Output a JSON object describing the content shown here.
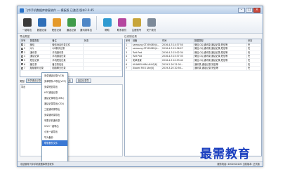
{
  "window": {
    "title": "飞华手机数据库修复软件 — 模板版 已激活 版本2.0.45",
    "controls": [
      "–",
      "□",
      "×"
    ]
  },
  "toolbar": {
    "items": [
      {
        "label": "一键导出",
        "icon": "phone-export-icon",
        "color": "#3a3a3a"
      },
      {
        "label": "数据记录",
        "icon": "phone-records-icon",
        "color": "#2f6fb8"
      },
      {
        "label": "短信记录",
        "icon": "sms-icon",
        "color": "#e59a2b"
      },
      {
        "label": "通话记录",
        "icon": "call-log-icon",
        "color": "#3f9b4a"
      },
      {
        "label": "通讯录导出",
        "icon": "contacts-icon",
        "color": "#4f87c7"
      },
      {
        "label": "帮助",
        "icon": "help-icon",
        "color": "#2f9ad1"
      },
      {
        "label": "联系我们",
        "icon": "contact-us-icon",
        "color": "#b5479f"
      },
      {
        "label": "注册账号",
        "icon": "register-icon",
        "color": "#c8a53a"
      },
      {
        "label": "关于我们",
        "icon": "about-icon",
        "color": "#7d8a99"
      }
    ]
  },
  "left_panel": {
    "label": "导出类型",
    "columns": [
      "序号",
      "数据类型",
      "备注",
      "状态"
    ],
    "rows": [
      {
        "no": "1",
        "type": "微信",
        "note": "微信消息记录文件",
        "status": ""
      },
      {
        "no": "2",
        "type": "QQ",
        "note": "QQ聊天记录",
        "status": ""
      },
      {
        "no": "3",
        "type": "通讯录",
        "note": "手机通讯录",
        "status": ""
      },
      {
        "no": "4",
        "type": "通话记录",
        "note": "手机通话记录",
        "status": ""
      },
      {
        "no": "5",
        "type": "短信记录",
        "note": "手机短信记录",
        "status": ""
      },
      {
        "no": "6",
        "type": "备忘录",
        "note": "备忘录信息",
        "status": ""
      },
      {
        "no": "7",
        "type": "陌陌聊天记录",
        "note": "陌陌聊天记录",
        "status": ""
      }
    ]
  },
  "controls_row": {
    "type_label": "类型:",
    "selected": "安卓通话记录(VCB)",
    "export_button": "开始导出",
    "all_button": "选定记录导"
  },
  "dropdown": {
    "items": [
      "安卓通话记录(VCB)",
      "安卓联系人导出(VCF)",
      "安卓短信导出",
      "HTC通话记录",
      "通话记录导出(XML)",
      "通话记录导出(CSV)",
      "三星通讯录导出",
      "安卓通讯录导出",
      "苹果手机通讯录",
      "VIVO一键导出",
      "小米一键导出",
      "华为备份",
      "联想备份文件"
    ],
    "selected_index": 12
  },
  "right_panel": {
    "label": "已识别记录",
    "columns": [
      "序号",
      "设备",
      "时间",
      "数据类型",
      "状态"
    ],
    "rows": [
      {
        "no": "1",
        "device": "samsung GT-I9508V(4...",
        "time": "2016-4-3 14:37:50",
        "type": "微信,QQ,通讯录,通话记录,短信等",
        "status": "完"
      },
      {
        "no": "2",
        "device": "samsung GT-I9508V(4...",
        "time": "2016-4-3 15:36:27",
        "type": "微信,QQ,通讯录,通话记录,短信等",
        "status": "完"
      },
      {
        "no": "3",
        "device": "Tsht Pad",
        "time": "2016-4-3 15:02:34",
        "type": "微信,QQ,通讯录,通话记录,短信等",
        "status": "完"
      },
      {
        "no": "4",
        "device": "Tsht Pad",
        "time": "2016-4-3 15:37:33",
        "type": "微信,QQ,通讯录,通话记录,短信等",
        "status": "完"
      },
      {
        "no": "5",
        "device": "安卓设置",
        "time": "2016-4-5 10:53:42",
        "type": "微信,QQ,通讯录,通话记录,短信等",
        "status": "完"
      },
      {
        "no": "6",
        "device": "HUAWEI-HMA-AL00[6]",
        "time": "2019-2-26 21:00...",
        "type": "通讯录,通话记录,短信等",
        "status": "完"
      },
      {
        "no": "7",
        "device": "Xiaomi MI 8 Lite[6]",
        "time": "2019-3-20 20:56...",
        "type": "通讯录,通话记录,短信等",
        "status": "完"
      }
    ]
  },
  "status_bar": {
    "left": "欢迎使用飞华手机数据库修复软件",
    "right": "服务电话: 4001002200  当前版本: 正式版"
  },
  "watermark": "最需教育"
}
